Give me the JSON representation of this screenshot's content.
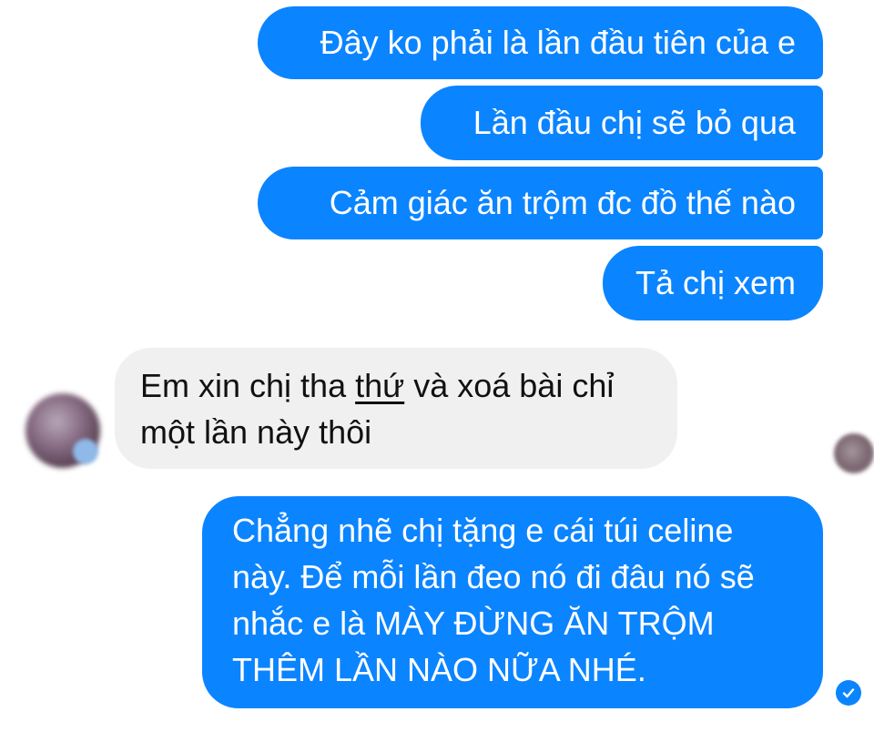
{
  "messages": [
    {
      "direction": "sent",
      "text": "Đây ko phải là lần đầu tiên của e"
    },
    {
      "direction": "sent",
      "text": "Lần đầu chị sẽ bỏ qua"
    },
    {
      "direction": "sent",
      "text": "Cảm giác ăn trộm đc đồ thế nào"
    },
    {
      "direction": "sent",
      "text": "Tả chị xem"
    },
    {
      "direction": "received",
      "line1_before": "Em xin chị tha ",
      "line1_underlined": "thứ",
      "line1_after": " và xoá bài chỉ",
      "line2": "một lần này thôi"
    },
    {
      "direction": "sent",
      "lines": [
        "Chẳng nhẽ chị tặng e cái túi celine",
        "này. Để mỗi lần đeo nó đi đâu nó sẽ",
        "nhắc e là MÀY ĐỪNG ĂN TRỘM",
        "THÊM LẦN NÀO NỮA NHÉ."
      ]
    }
  ],
  "colors": {
    "sent_bubble": "#0b84ff",
    "received_bubble": "#f0f0f0",
    "sent_text": "#ffffff",
    "received_text": "#111111"
  },
  "icons": {
    "read_receipt": "check-circle-icon",
    "contact_avatar": "avatar",
    "seen_avatar": "avatar"
  }
}
